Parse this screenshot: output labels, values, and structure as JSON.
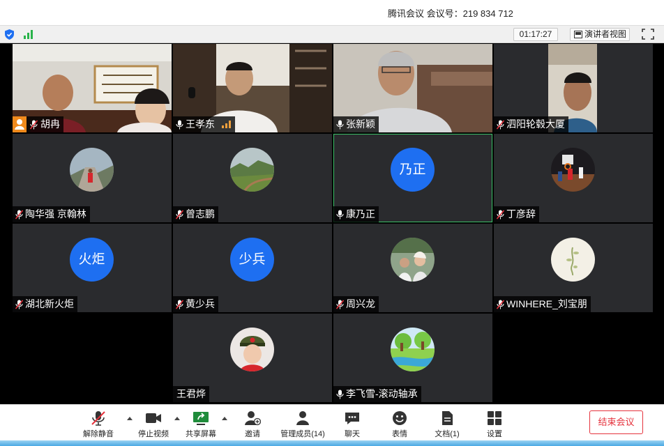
{
  "window": {
    "title": "腾讯会议 会议号：219 834 712",
    "timer": "01:17:27",
    "speaker_view_label": "演讲者视图"
  },
  "colors": {
    "avatar_blue": "#1e6ff1",
    "end_red": "#e5323c",
    "active_speaker_border": "#3cc46a",
    "host_badge": "#f08a1c"
  },
  "participants": [
    {
      "name": "胡冉",
      "mode": "video",
      "icon": "host-and-muted-mic-icon"
    },
    {
      "name": "王孝东",
      "mode": "video",
      "icon": "mic-icon",
      "speaking": true
    },
    {
      "name": "张新颖",
      "mode": "video",
      "icon": "mic-icon"
    },
    {
      "name": "泗阳轮毂大厦",
      "mode": "video",
      "icon": "muted-mic-icon"
    },
    {
      "name": "陶华强 京翰林",
      "mode": "photo-avatar",
      "icon": "muted-mic-icon"
    },
    {
      "name": "曾志鹏",
      "mode": "photo-avatar",
      "icon": "muted-mic-icon"
    },
    {
      "name": "康乃正",
      "mode": "text-avatar",
      "avatar_text": "乃正",
      "icon": "mic-icon",
      "active": true
    },
    {
      "name": "丁彦辞",
      "mode": "photo-avatar",
      "icon": "muted-mic-icon"
    },
    {
      "name": "湖北新火炬",
      "mode": "text-avatar",
      "avatar_text": "火炬",
      "icon": "muted-mic-icon"
    },
    {
      "name": "黄少兵",
      "mode": "text-avatar",
      "avatar_text": "少兵",
      "icon": "muted-mic-icon"
    },
    {
      "name": "周兴龙",
      "mode": "photo-avatar",
      "icon": "muted-mic-icon"
    },
    {
      "name": "WINHERE_刘宝朋",
      "mode": "photo-avatar",
      "icon": "muted-mic-icon"
    },
    {
      "name": "王君烨",
      "mode": "photo-avatar",
      "icon": "none"
    },
    {
      "name": "李飞雪-滚动轴承",
      "mode": "photo-avatar",
      "icon": "mic-icon"
    }
  ],
  "toolbar": {
    "unmute": "解除静音",
    "stop_video": "停止视频",
    "share_screen": "共享屏幕",
    "invite": "邀请",
    "manage_members": "管理成员(14)",
    "chat": "聊天",
    "reactions": "表情",
    "docs": "文档(1)",
    "settings": "设置",
    "end_meeting": "结束会议"
  }
}
